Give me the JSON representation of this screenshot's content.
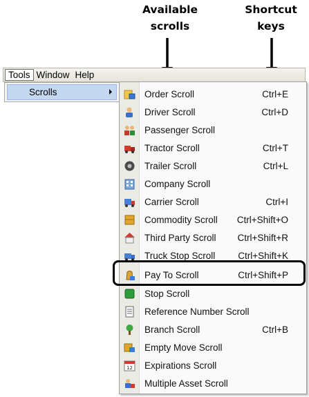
{
  "callouts": {
    "available_line1": "Available",
    "available_line2": "scrolls",
    "shortcut_line1": "Shortcut",
    "shortcut_line2": "keys"
  },
  "menubar": {
    "items": [
      {
        "label": "Tools"
      },
      {
        "label": "Window"
      },
      {
        "label": "Help"
      }
    ]
  },
  "tools_menu": {
    "scrolls_label": "Scrolls"
  },
  "scroll_menu": {
    "items": [
      {
        "label": "Order Scroll",
        "shortcut": "Ctrl+E",
        "icon": "order-scroll-icon"
      },
      {
        "label": "Driver Scroll",
        "shortcut": "Ctrl+D",
        "icon": "driver-scroll-icon"
      },
      {
        "label": "Passenger Scroll",
        "shortcut": "",
        "icon": "passenger-scroll-icon"
      },
      {
        "label": "Tractor Scroll",
        "shortcut": "Ctrl+T",
        "icon": "tractor-scroll-icon"
      },
      {
        "label": "Trailer Scroll",
        "shortcut": "Ctrl+L",
        "icon": "trailer-scroll-icon"
      },
      {
        "label": "Company Scroll",
        "shortcut": "",
        "icon": "company-scroll-icon"
      },
      {
        "label": "Carrier Scroll",
        "shortcut": "Ctrl+I",
        "icon": "carrier-scroll-icon"
      },
      {
        "label": "Commodity Scroll",
        "shortcut": "Ctrl+Shift+O",
        "icon": "commodity-scroll-icon"
      },
      {
        "label": "Third Party Scroll",
        "shortcut": "Ctrl+Shift+R",
        "icon": "third-party-scroll-icon"
      },
      {
        "label": "Truck Stop Scroll",
        "shortcut": "Ctrl+Shift+K",
        "icon": "truck-stop-scroll-icon"
      },
      {
        "label": "Pay To Scroll",
        "shortcut": "Ctrl+Shift+P",
        "icon": "pay-to-scroll-icon"
      },
      {
        "label": "Stop Scroll",
        "shortcut": "",
        "icon": "stop-scroll-icon"
      },
      {
        "label": "Reference Number Scroll",
        "shortcut": "",
        "icon": "reference-number-scroll-icon"
      },
      {
        "label": "Branch Scroll",
        "shortcut": "Ctrl+B",
        "icon": "branch-scroll-icon"
      },
      {
        "label": "Empty Move Scroll",
        "shortcut": "",
        "icon": "empty-move-scroll-icon"
      },
      {
        "label": "Expirations Scroll",
        "shortcut": "",
        "icon": "expirations-scroll-icon",
        "icon_text": "12"
      },
      {
        "label": "Multiple Asset Scroll",
        "shortcut": "",
        "icon": "multiple-asset-scroll-icon"
      }
    ]
  }
}
